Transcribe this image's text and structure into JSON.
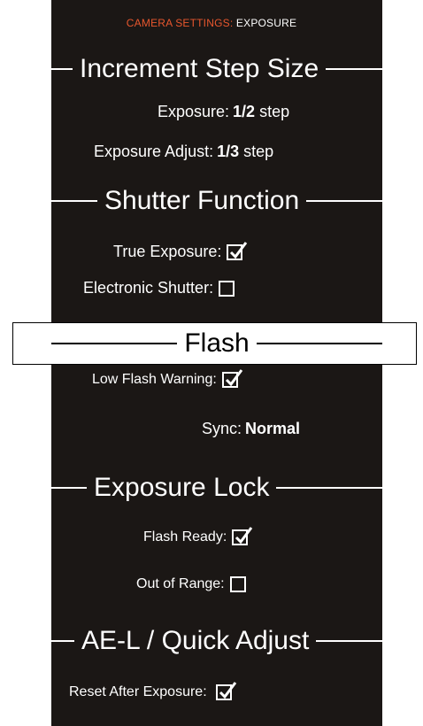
{
  "header": {
    "accent": "CAMERA SETTINGS:",
    "page": "EXPOSURE"
  },
  "increment": {
    "title": "Increment Step Size",
    "exposure_label": "Exposure:",
    "exposure_value": "1/2",
    "exposure_unit": "step",
    "adjust_label": "Exposure Adjust:",
    "adjust_value": "1/3",
    "adjust_unit": "step"
  },
  "shutter": {
    "title": "Shutter Function",
    "true_exposure_label": "True Exposure:",
    "true_exposure_checked": true,
    "electronic_label": "Electronic Shutter:",
    "electronic_checked": false
  },
  "flash": {
    "title": "Flash",
    "low_warning_label": "Low Flash Warning:",
    "low_warning_checked": true,
    "sync_label": "Sync:",
    "sync_value": "Normal"
  },
  "exposure_lock": {
    "title": "Exposure Lock",
    "flash_ready_label": "Flash Ready:",
    "flash_ready_checked": true,
    "out_of_range_label": "Out of Range:",
    "out_of_range_checked": false
  },
  "ae_l": {
    "title": "AE-L / Quick Adjust",
    "reset_label": "Reset After Exposure:",
    "reset_checked": true
  },
  "colors": {
    "background": "#1b1715",
    "text": "#ffffff",
    "accent": "#e8572e"
  }
}
